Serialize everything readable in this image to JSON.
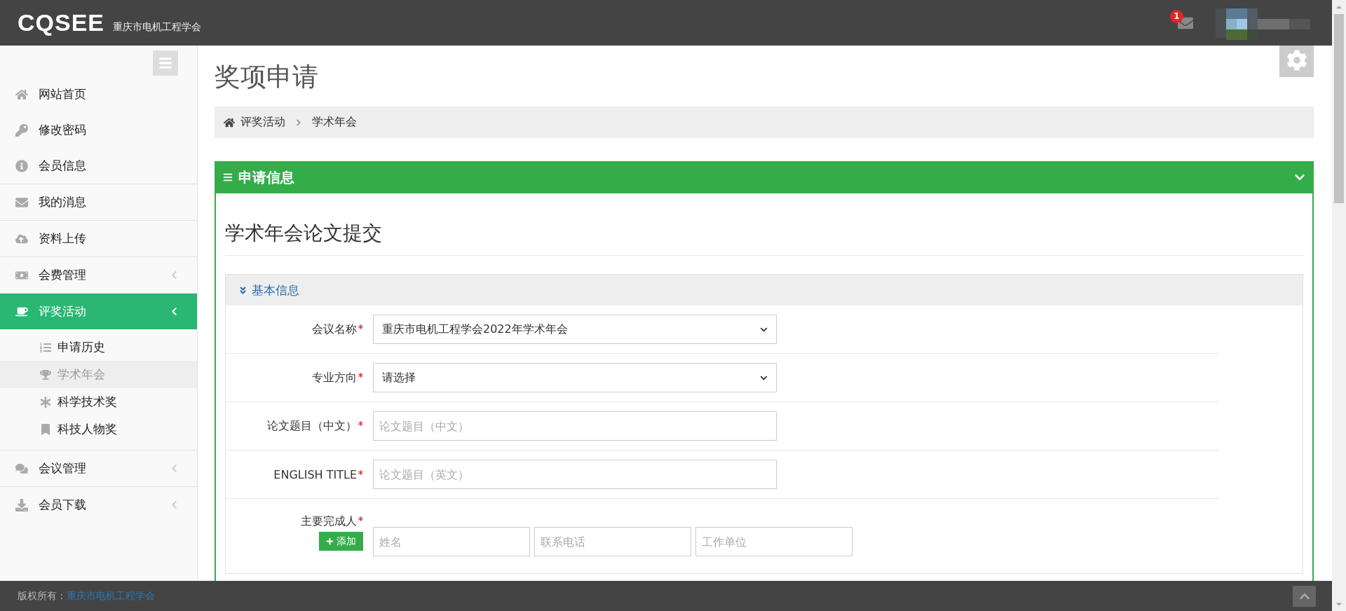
{
  "header": {
    "logo_text": "CQSEE",
    "org_name": "重庆市电机工程学会",
    "message_count": "1"
  },
  "sidebar": {
    "sections": [
      {
        "items": [
          {
            "label": "网站首页",
            "selected": false
          },
          {
            "label": "修改密码",
            "selected": false
          },
          {
            "label": "会员信息",
            "selected": false
          }
        ]
      },
      {
        "items": [
          {
            "label": "我的消息",
            "selected": false
          }
        ]
      },
      {
        "items": [
          {
            "label": "资料上传",
            "selected": false
          }
        ]
      },
      {
        "items": [
          {
            "label": "会费管理",
            "selected": false,
            "expandable": true
          }
        ]
      },
      {
        "items": [
          {
            "label": "评奖活动",
            "selected": true,
            "expandable": true,
            "expanded": true,
            "children": [
              {
                "label": "申请历史",
                "selected": false
              },
              {
                "label": "学术年会",
                "selected": true
              },
              {
                "label": "科学技术奖",
                "selected": false
              },
              {
                "label": "科技人物奖",
                "selected": false
              }
            ]
          }
        ]
      },
      {
        "items": [
          {
            "label": "会议管理",
            "selected": false,
            "expandable": true
          }
        ]
      },
      {
        "items": [
          {
            "label": "会员下载",
            "selected": false,
            "expandable": true
          }
        ]
      }
    ]
  },
  "page_title": "奖项申请",
  "breadcrumb": [
    "评奖活动",
    "学术年会"
  ],
  "panel": {
    "title": "申请信息",
    "form_title": "学术年会论文提交",
    "section": {
      "title": "基本信息",
      "fields": [
        {
          "label": "会议名称",
          "required": true,
          "kind": "select",
          "value": "重庆市电机工程学会2022年学术年会"
        },
        {
          "label": "专业方向",
          "required": true,
          "kind": "select",
          "value": "请选择"
        },
        {
          "label": "论文题目（中文）",
          "required": true,
          "kind": "input",
          "placeholder": "论文题目（中文）"
        },
        {
          "label": "ENGLISH TITLE",
          "required": true,
          "kind": "input",
          "placeholder": "论文题目（英文）"
        }
      ],
      "persons": {
        "label": "主要完成人",
        "required": true,
        "add_button": "添加",
        "placeholders": [
          "姓名",
          "联系电话",
          "工作单位"
        ]
      }
    }
  },
  "footer": {
    "copyright_label": "版权所有：",
    "copyright_link": "重庆市电机工程学会"
  }
}
